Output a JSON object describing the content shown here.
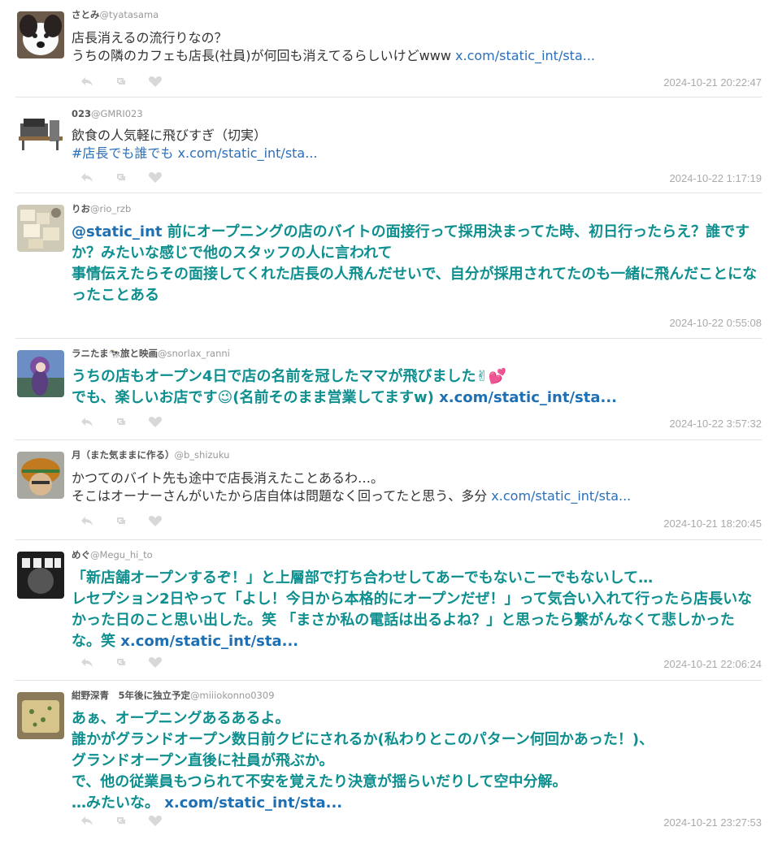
{
  "tweets": [
    {
      "name": "さとみ",
      "handle": "@tyatasama",
      "lines": [
        "店長消えるの流行りなの？",
        "うちの隣のカフェも店長(社員)が何回も消えてるらしいけどwww "
      ],
      "link": "x.com/static_int/sta...",
      "timestamp": "2024-10-21 20:22:47",
      "avatar": "dog-photo"
    },
    {
      "name": "023",
      "handle": "@GMRI023",
      "lines": [
        "飲食の人気軽に飛びすぎ（切実）"
      ],
      "hashtag": "#店長でも誰でも",
      "link": "x.com/static_int/sta...",
      "timestamp": "2024-10-22 1:17:19",
      "avatar": "desk-photo"
    },
    {
      "name": "りお",
      "handle": "@rio_rzb",
      "mention": "@static_int",
      "lines": [
        " 前にオープニングの店のバイトの面接行って採用決まってた時、初日行ったらえ？誰ですか？みたいな感じで他のスタッフの人に言われて",
        "事情伝えたらその面接してくれた店長の人飛んだせいで、自分が採用されてたのも一緒に飛んだことになったことある"
      ],
      "timestamp": "2024-10-22 0:55:08",
      "avatar": "food-photo"
    },
    {
      "name": "ラニたま🐄旅と映画",
      "handle": "@snorlax_ranni",
      "lines": [
        "うちの店もオープン4日で店の名前を冠したママが飛びました✌💕",
        "でも、楽しいお店です😉(名前そのまま営業してますw) "
      ],
      "link": "x.com/static_int/sta...",
      "timestamp": "2024-10-22 3:57:32",
      "avatar": "anime-photo"
    },
    {
      "name": "月（また気ままに作る）",
      "handle": "@b_shizuku",
      "lines": [
        "かつてのバイト先も途中で店長消えたことあるわ…。",
        "そこはオーナーさんがいたから店自体は問題なく回ってたと思う、多分 "
      ],
      "link": "x.com/static_int/sta...",
      "timestamp": "2024-10-21 18:20:45",
      "avatar": "hat-illustration"
    },
    {
      "name": "めぐ",
      "handle": "@Megu_hi_to",
      "lines": [
        "「新店舗オープンするぞ！」と上層部で打ち合わせしてあーでもないこーでもないして…",
        "レセプション2日やって「よし！今日から本格的にオープンだぜ！」って気合い入れて行ったら店長いなかった日のこと思い出した。笑 「まさか私の電話は出るよね？」と思ったら繋がんなくて悲しかったな。笑 "
      ],
      "link": "x.com/static_int/sta...",
      "timestamp": "2024-10-21 22:06:24",
      "avatar": "dark-logo"
    },
    {
      "name": "紺野深青　5年後に独立予定",
      "handle": "@miiiokonno0309",
      "lines": [
        "あぁ、オープニングあるあるよ。",
        "誰かがグランドオープン数日前クビにされるか(私わりとこのパターン何回かあった！)、",
        "グランドオープン直後に社員が飛ぶか。",
        "で、他の従業員もつられて不安を覚えたり決意が揺らいだりして空中分解。",
        "…みたいな。 "
      ],
      "link": "x.com/static_int/sta...",
      "timestamp": "2024-10-21 23:27:53",
      "avatar": "cake-photo"
    }
  ]
}
